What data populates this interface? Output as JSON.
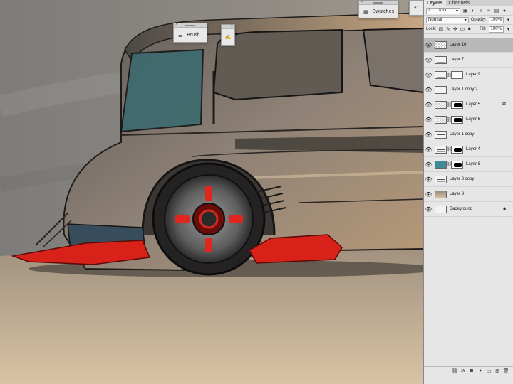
{
  "panels": {
    "brush": {
      "label": "Brush..."
    },
    "swatches": {
      "label": "Swatches"
    }
  },
  "layers_panel": {
    "tabs": [
      "Layers",
      "Channels"
    ],
    "filter_kind": "Kind",
    "blend_mode": "Normal",
    "opacity_label": "Opacity:",
    "opacity_value": "100%",
    "lock_label": "Lock:",
    "fill_label": "Fill:",
    "fill_value": "100%",
    "layers": [
      {
        "name": "Layer 10",
        "thumb": "checker",
        "mask": false,
        "selected": true
      },
      {
        "name": "Layer 7",
        "thumb": "sketch",
        "mask": false
      },
      {
        "name": "Layer 9",
        "thumb": "sketch",
        "mask": "white"
      },
      {
        "name": "Layer 1 copy 2",
        "thumb": "sketch",
        "mask": false
      },
      {
        "name": "Layer 5",
        "thumb": "checker",
        "mask": "black",
        "badge": "link"
      },
      {
        "name": "Layer 6",
        "thumb": "checker",
        "mask": "black"
      },
      {
        "name": "Layer 1 copy",
        "thumb": "sketch",
        "mask": false
      },
      {
        "name": "Layer 4",
        "thumb": "sketch",
        "mask": "black"
      },
      {
        "name": "Layer 8",
        "thumb": "teal",
        "mask": "black"
      },
      {
        "name": "Layer 3 copy",
        "thumb": "sketch",
        "mask": false
      },
      {
        "name": "Layer 3",
        "thumb": "gradient",
        "mask": false
      },
      {
        "name": "Background",
        "thumb": "plain",
        "mask": false,
        "badge": "lock"
      }
    ],
    "bottom_icons": [
      "link-icon",
      "fx-icon",
      "mask-icon",
      "adjustment-icon",
      "folder-icon",
      "new-layer-icon",
      "trash-icon"
    ]
  },
  "colors": {
    "accent_red": "#e0261e",
    "panel_bg": "#e6e6e6",
    "selected_row": "#b8b8b8"
  }
}
